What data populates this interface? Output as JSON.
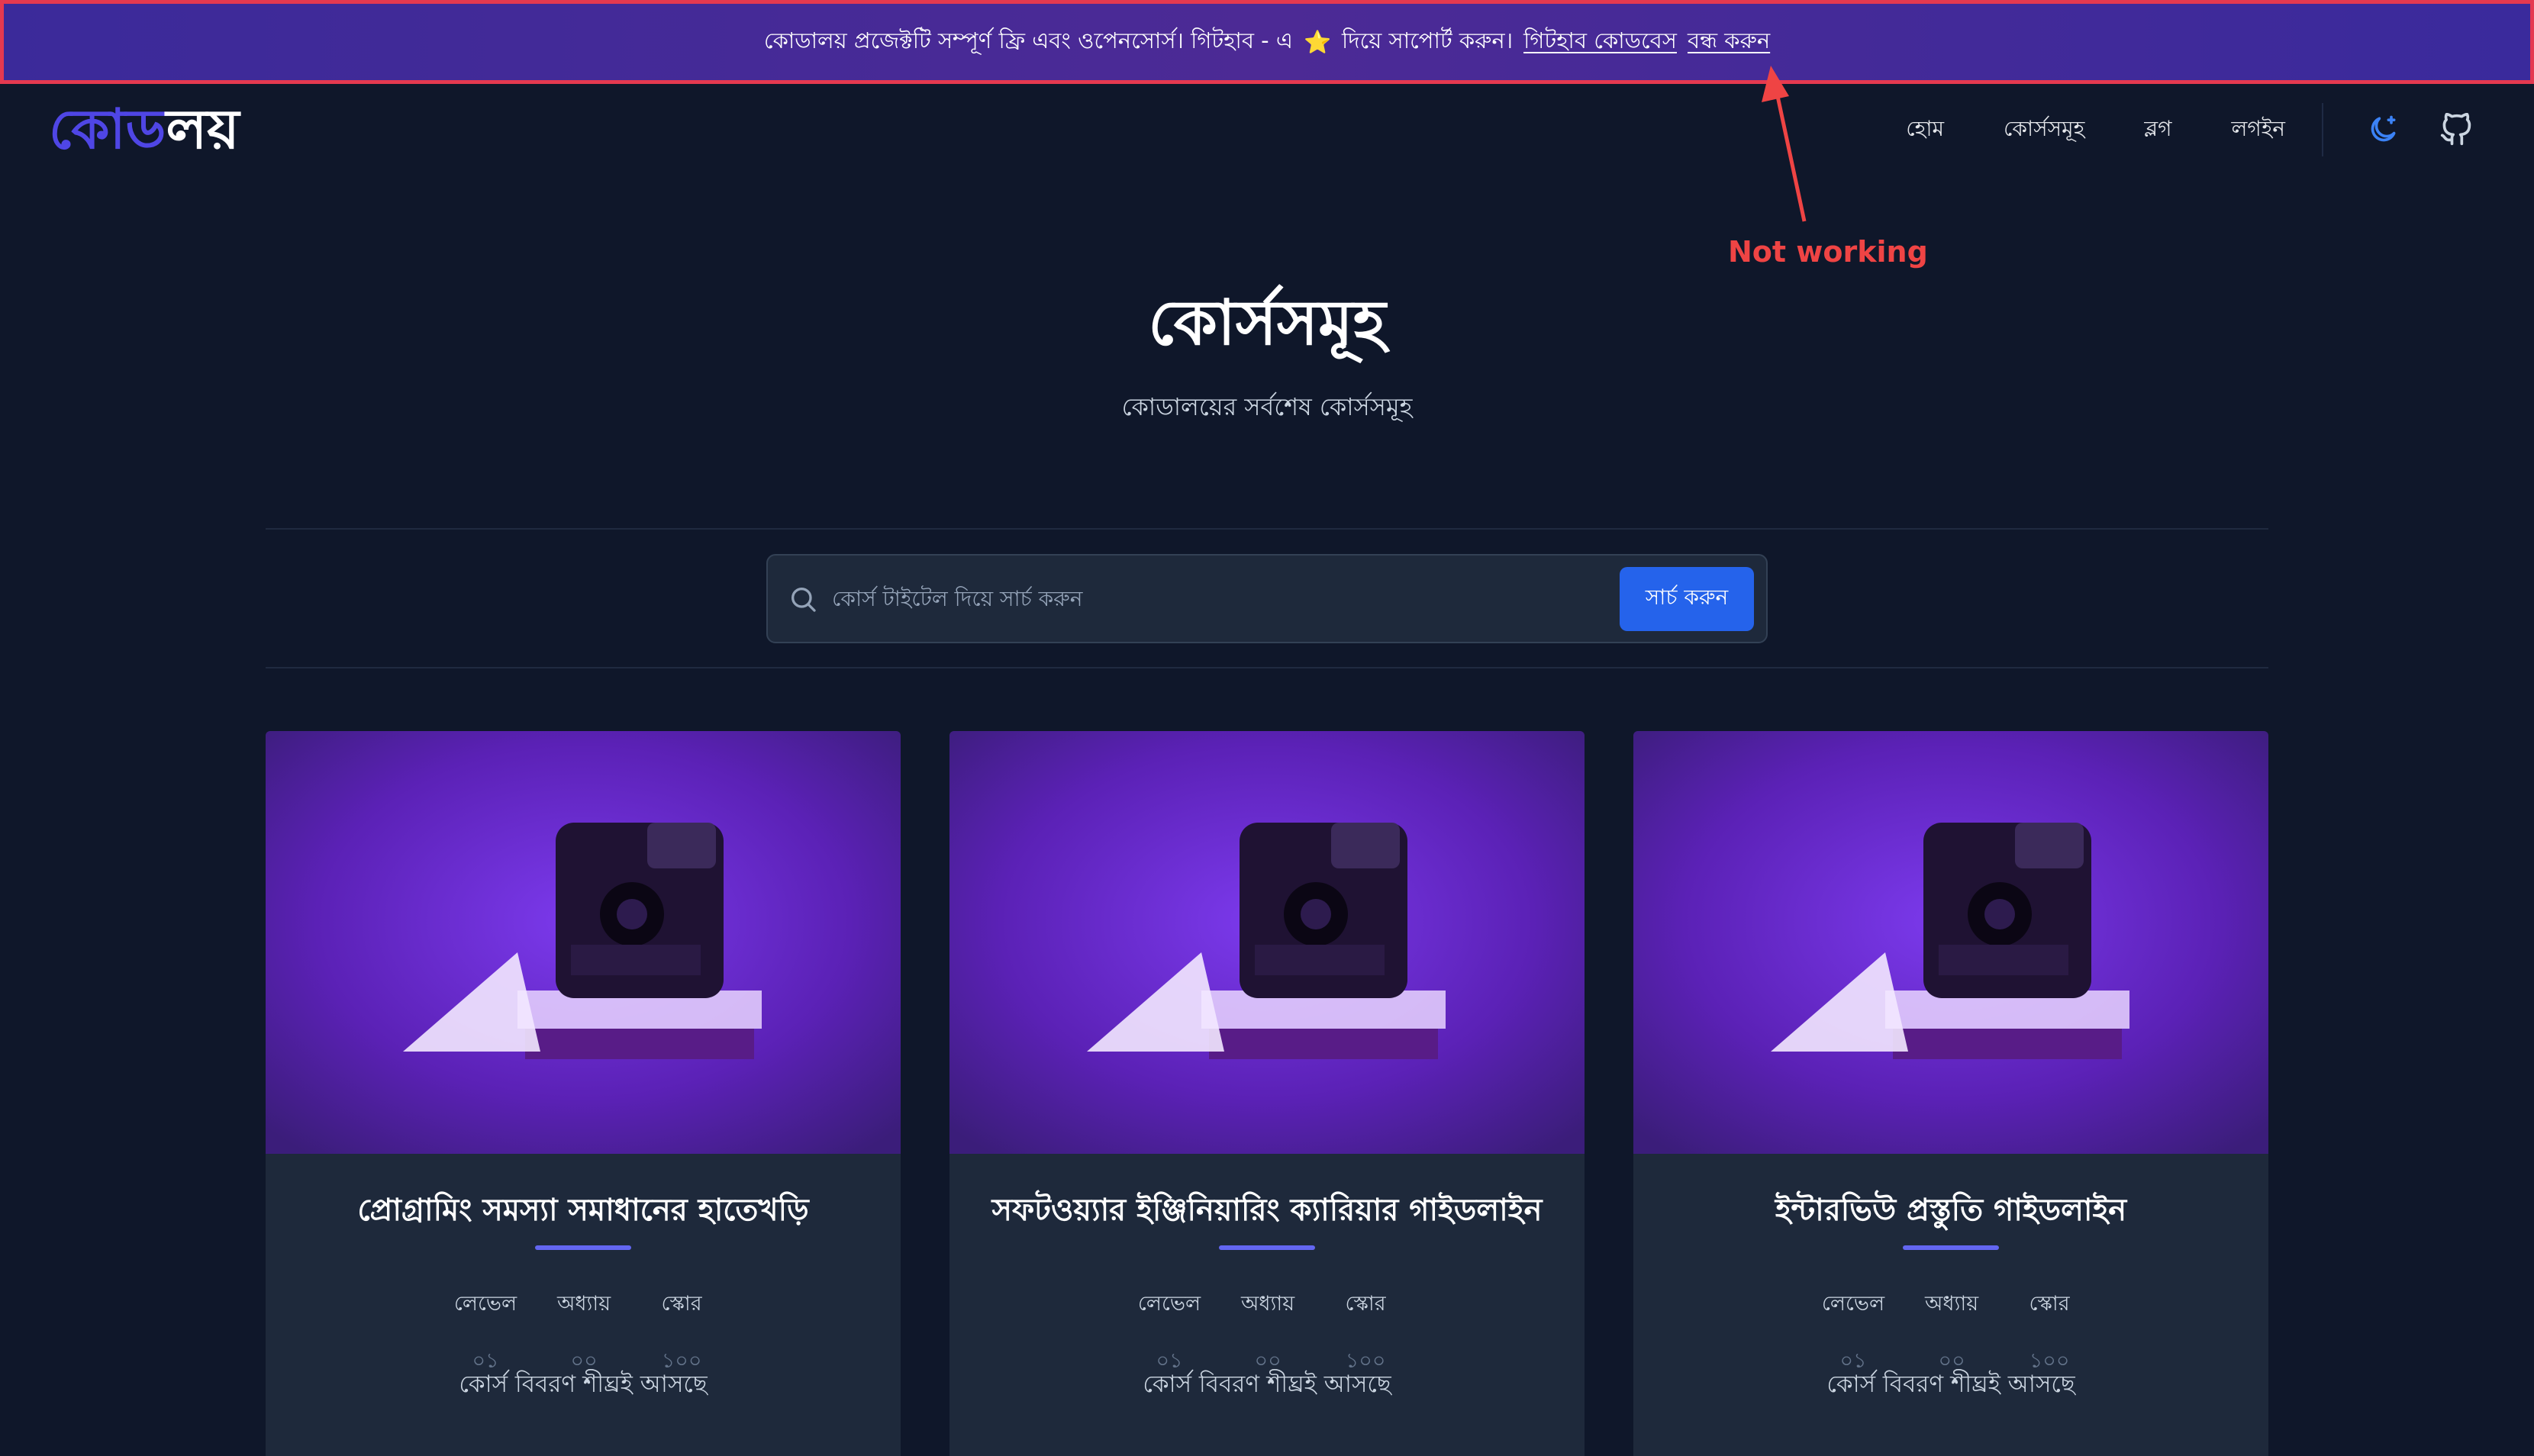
{
  "banner": {
    "message": "কোডালয় প্রজেক্টটি সম্পূর্ণ ফ্রি এবং ওপেনসোর্স। গিটহাব - এ",
    "star": "⭐",
    "message_tail": "দিয়ে সাপোর্ট করুন।",
    "link_github": "গিটহাব কোডবেস",
    "link_close": "বন্ধ করুন"
  },
  "header": {
    "logo_part1": "কোড",
    "logo_part2": "লয়",
    "nav": [
      "হোম",
      "কোর্সসমূহ",
      "ব্লগ",
      "লগইন"
    ],
    "theme_icon": "moon-star-icon",
    "github_icon": "github-icon"
  },
  "annotation": {
    "text": "Not working",
    "color": "#ef4444"
  },
  "hero": {
    "title": "কোর্সসমূহ",
    "subtitle": "কোডালয়ের সর্বশেষ কোর্সসমূহ"
  },
  "search": {
    "placeholder": "কোর্স টাইটেল দিয়ে সার্চ করুন",
    "value": "",
    "button": "সার্চ করুন"
  },
  "courses": [
    {
      "title": "প্রোগ্রামিং সমস্যা সমাধানের হাতেখড়ি",
      "stats": [
        {
          "label": "লেভেল",
          "value": "০১"
        },
        {
          "label": "অধ্যায়",
          "value": "০০"
        },
        {
          "label": "স্কোর",
          "value": "১০০"
        }
      ],
      "description": "কোর্স বিবরণ শীঘ্রই আসছে"
    },
    {
      "title": "সফটওয়্যার ইঞ্জিনিয়ারিং ক্যারিয়ার গাইডলাইন",
      "stats": [
        {
          "label": "লেভেল",
          "value": "০১"
        },
        {
          "label": "অধ্যায়",
          "value": "০০"
        },
        {
          "label": "স্কোর",
          "value": "১০০"
        }
      ],
      "description": "কোর্স বিবরণ শীঘ্রই আসছে"
    },
    {
      "title": "ইন্টারভিউ প্রস্তুতি গাইডলাইন",
      "stats": [
        {
          "label": "লেভেল",
          "value": "০১"
        },
        {
          "label": "অধ্যায়",
          "value": "০০"
        },
        {
          "label": "স্কোর",
          "value": "১০০"
        }
      ],
      "description": "কোর্স বিবরণ শীঘ্রই আসছে"
    }
  ],
  "colors": {
    "background": "#0f172a",
    "card": "#1e293b",
    "accent": "#2563eb",
    "logo": "#4f46e5",
    "annotation": "#e53950"
  }
}
